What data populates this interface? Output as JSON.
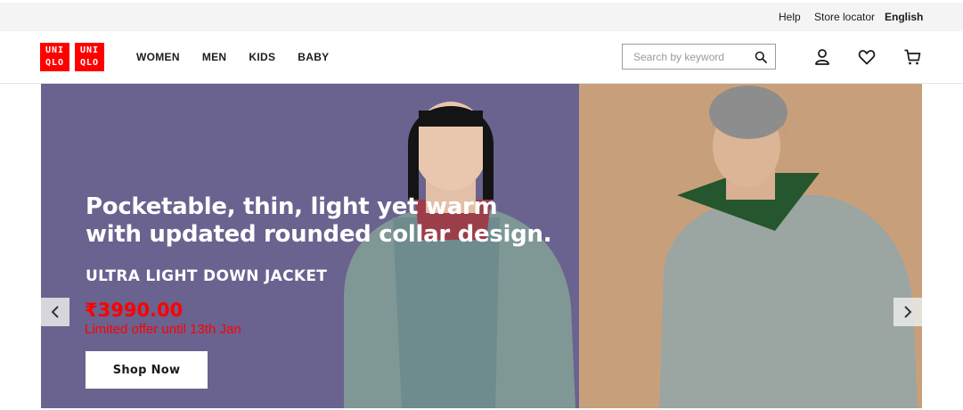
{
  "utility": {
    "help": "Help",
    "store_locator": "Store locator",
    "language": "English"
  },
  "logo": {
    "line1": "UNI",
    "line2": "QLO",
    "line3": "UNI",
    "line4": "QLO"
  },
  "nav": [
    "WOMEN",
    "MEN",
    "KIDS",
    "BABY"
  ],
  "search": {
    "placeholder": "Search by keyword"
  },
  "hero": {
    "headline_line1": "Pocketable, thin, light yet warm",
    "headline_line2": "with updated rounded collar design.",
    "product": "ULTRA LIGHT DOWN JACKET",
    "price": "₹3990.00",
    "offer": "Limited offer until 13th Jan",
    "cta": "Shop Now"
  },
  "icons": [
    "search-icon",
    "account-icon",
    "wishlist-icon",
    "cart-icon",
    "chevron-left-icon",
    "chevron-right-icon"
  ],
  "colors": {
    "brand_red": "#ff0000",
    "hero_left_bg": "#6a628f",
    "hero_right_bg": "#c7a07b",
    "price_red": "#ff0000"
  }
}
